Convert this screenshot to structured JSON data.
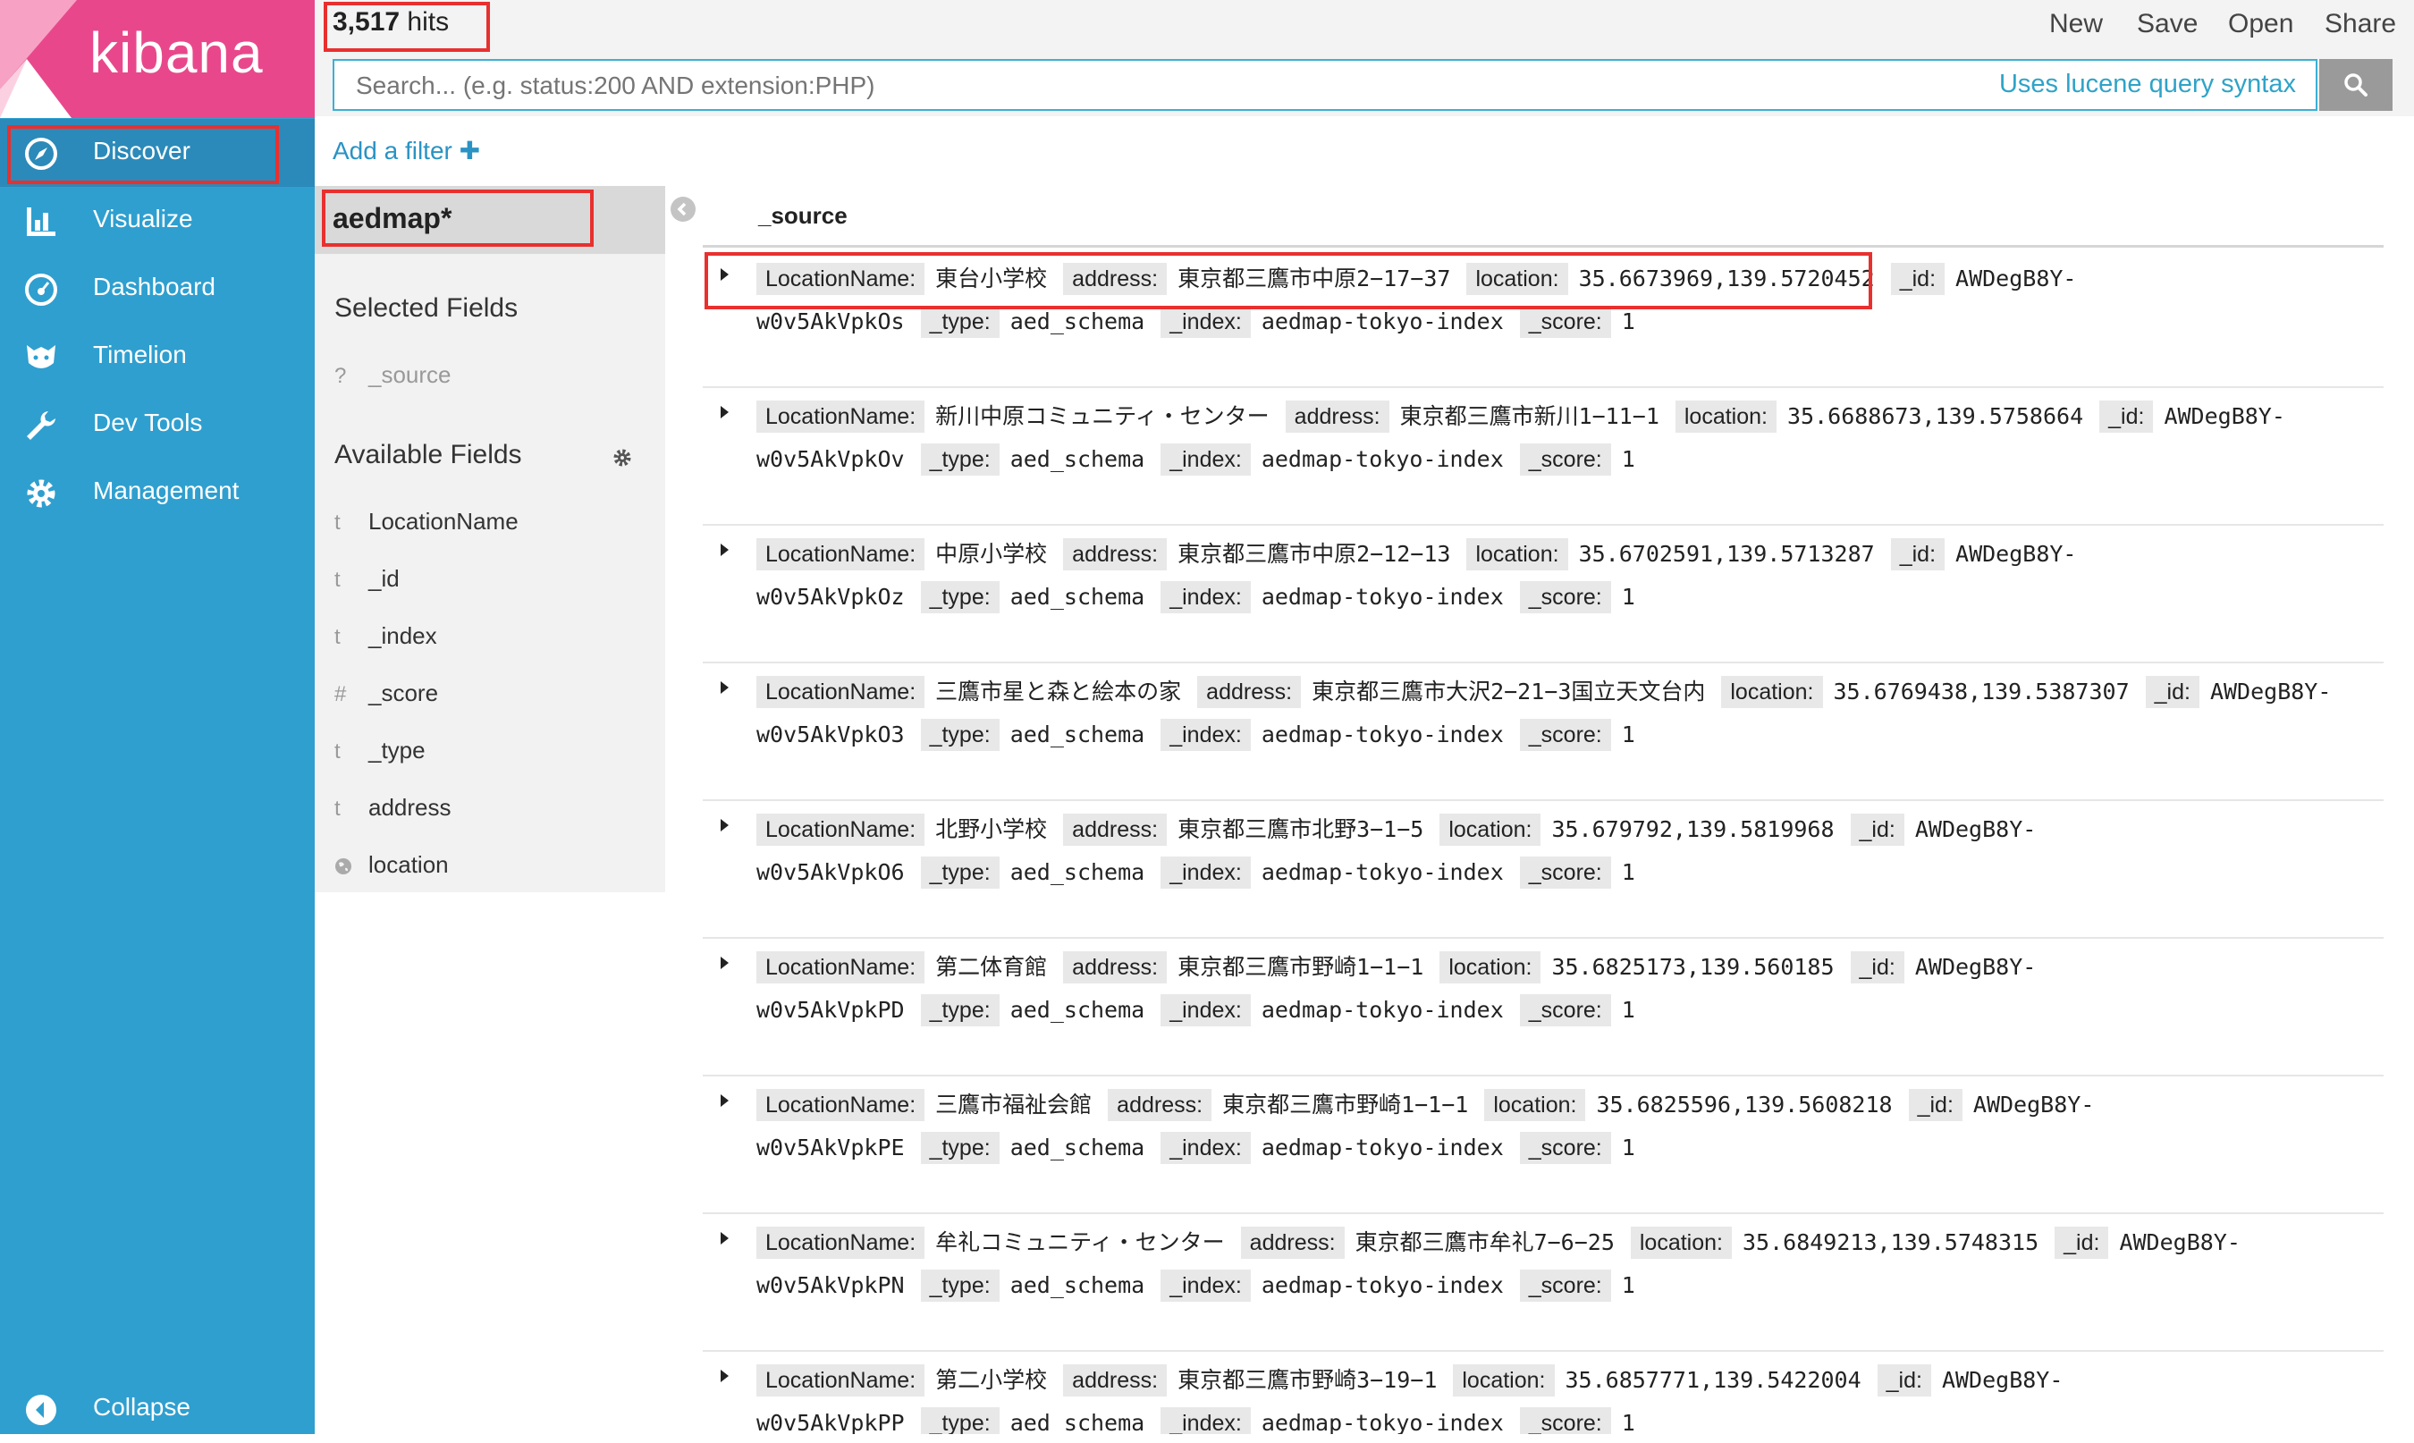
{
  "brand": {
    "name": "kibana"
  },
  "sidebar": {
    "items": [
      {
        "label": "Discover",
        "icon": "compass-icon",
        "active": true
      },
      {
        "label": "Visualize",
        "icon": "bar-chart-icon"
      },
      {
        "label": "Dashboard",
        "icon": "dashboard-icon"
      },
      {
        "label": "Timelion",
        "icon": "timelion-icon"
      },
      {
        "label": "Dev Tools",
        "icon": "wrench-icon"
      },
      {
        "label": "Management",
        "icon": "gear-icon"
      }
    ],
    "collapse_label": "Collapse"
  },
  "topbar": {
    "hits_count": "3,517",
    "hits_label": "hits",
    "actions": [
      "New",
      "Save",
      "Open",
      "Share"
    ]
  },
  "search": {
    "placeholder": "Search... (e.g. status:200 AND extension:PHP)",
    "value": "",
    "syntax_hint": "Uses lucene query syntax"
  },
  "filter": {
    "add_label": "Add a filter"
  },
  "index_pattern": "aedmap*",
  "fields_panel": {
    "selected_title": "Selected Fields",
    "selected": [
      {
        "type": "?",
        "name": "_source"
      }
    ],
    "available_title": "Available Fields",
    "available": [
      {
        "type": "t",
        "name": "LocationName"
      },
      {
        "type": "t",
        "name": "_id"
      },
      {
        "type": "t",
        "name": "_index"
      },
      {
        "type": "#",
        "name": "_score"
      },
      {
        "type": "t",
        "name": "_type"
      },
      {
        "type": "t",
        "name": "address"
      },
      {
        "type": "geo",
        "name": "location"
      }
    ]
  },
  "results": {
    "column_header": "_source",
    "docs": [
      {
        "LocationName": "東台小学校",
        "address": "東京都三鷹市中原2−17−37",
        "location": "35.6673969,139.5720452",
        "_id": "AWDegB8Y-w0v5AkVpkOs",
        "_type": "aed_schema",
        "_index": "aedmap-tokyo-index",
        "_score": "1"
      },
      {
        "LocationName": "新川中原コミュニティ・センター",
        "address": "東京都三鷹市新川1−11−1",
        "location": "35.6688673,139.5758664",
        "_id": "AWDegB8Y-w0v5AkVpkOv",
        "_type": "aed_schema",
        "_index": "aedmap-tokyo-index",
        "_score": "1"
      },
      {
        "LocationName": "中原小学校",
        "address": "東京都三鷹市中原2−12−13",
        "location": "35.6702591,139.5713287",
        "_id": "AWDegB8Y-w0v5AkVpkOz",
        "_type": "aed_schema",
        "_index": "aedmap-tokyo-index",
        "_score": "1"
      },
      {
        "LocationName": "三鷹市星と森と絵本の家",
        "address": "東京都三鷹市大沢2−21−3国立天文台内",
        "location": "35.6769438,139.5387307",
        "_id": "AWDegB8Y-w0v5AkVpkO3",
        "_type": "aed_schema",
        "_index": "aedmap-tokyo-index",
        "_score": "1"
      },
      {
        "LocationName": "北野小学校",
        "address": "東京都三鷹市北野3−1−5",
        "location": "35.679792,139.5819968",
        "_id": "AWDegB8Y-w0v5AkVpkO6",
        "_type": "aed_schema",
        "_index": "aedmap-tokyo-index",
        "_score": "1"
      },
      {
        "LocationName": "第二体育館",
        "address": "東京都三鷹市野崎1−1−1",
        "location": "35.6825173,139.560185",
        "_id": "AWDegB8Y-w0v5AkVpkPD",
        "_type": "aed_schema",
        "_index": "aedmap-tokyo-index",
        "_score": "1"
      },
      {
        "LocationName": "三鷹市福祉会館",
        "address": "東京都三鷹市野崎1−1−1",
        "location": "35.6825596,139.5608218",
        "_id": "AWDegB8Y-w0v5AkVpkPE",
        "_type": "aed_schema",
        "_index": "aedmap-tokyo-index",
        "_score": "1"
      },
      {
        "LocationName": "牟礼コミュニティ・センター",
        "address": "東京都三鷹市牟礼7−6−25",
        "location": "35.6849213,139.5748315",
        "_id": "AWDegB8Y-w0v5AkVpkPN",
        "_type": "aed_schema",
        "_index": "aedmap-tokyo-index",
        "_score": "1"
      },
      {
        "LocationName": "第二小学校",
        "address": "東京都三鷹市野崎3−19−1",
        "location": "35.6857771,139.5422004",
        "_id": "AWDegB8Y-w0v5AkVpkPP",
        "_type": "aed_schema",
        "_index": "aedmap-tokyo-index",
        "_score": "1"
      }
    ]
  },
  "colors": {
    "sidebar": "#2f9fcf",
    "sidebar_active": "#2b8ab9",
    "brand": "#e8488b",
    "link": "#2a93c4",
    "highlight_box": "#e8302f"
  }
}
